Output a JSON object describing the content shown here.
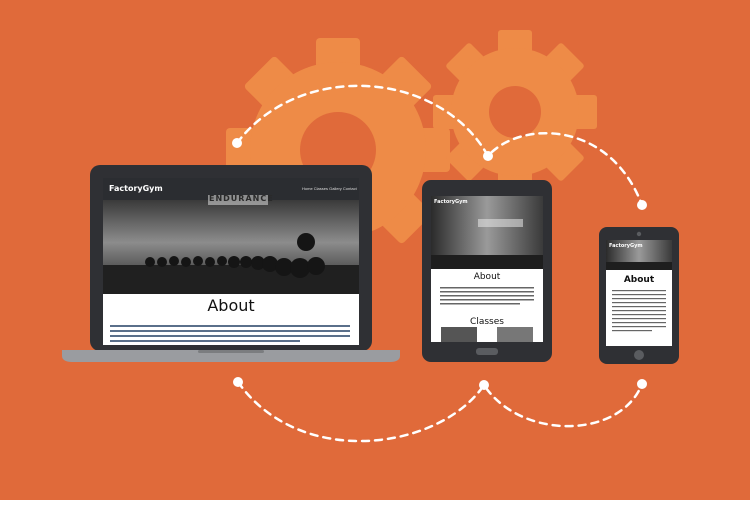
{
  "colors": {
    "background": "#E06A3A",
    "gear": "#EE8B47",
    "device_frame": "#2F3034",
    "laptop_base": "#9A9CA0",
    "dotted_path": "#FFFFFF"
  },
  "site": {
    "brand": "FactoryGym",
    "nav": "Home Classes Gallery Contact",
    "hero_wall_text": "ENDURANCE",
    "about_heading": "About",
    "classes_heading": "Classes"
  },
  "devices": [
    "laptop",
    "tablet",
    "phone"
  ],
  "icons": [
    "gear-icon",
    "gear-icon",
    "dotted-connector"
  ]
}
